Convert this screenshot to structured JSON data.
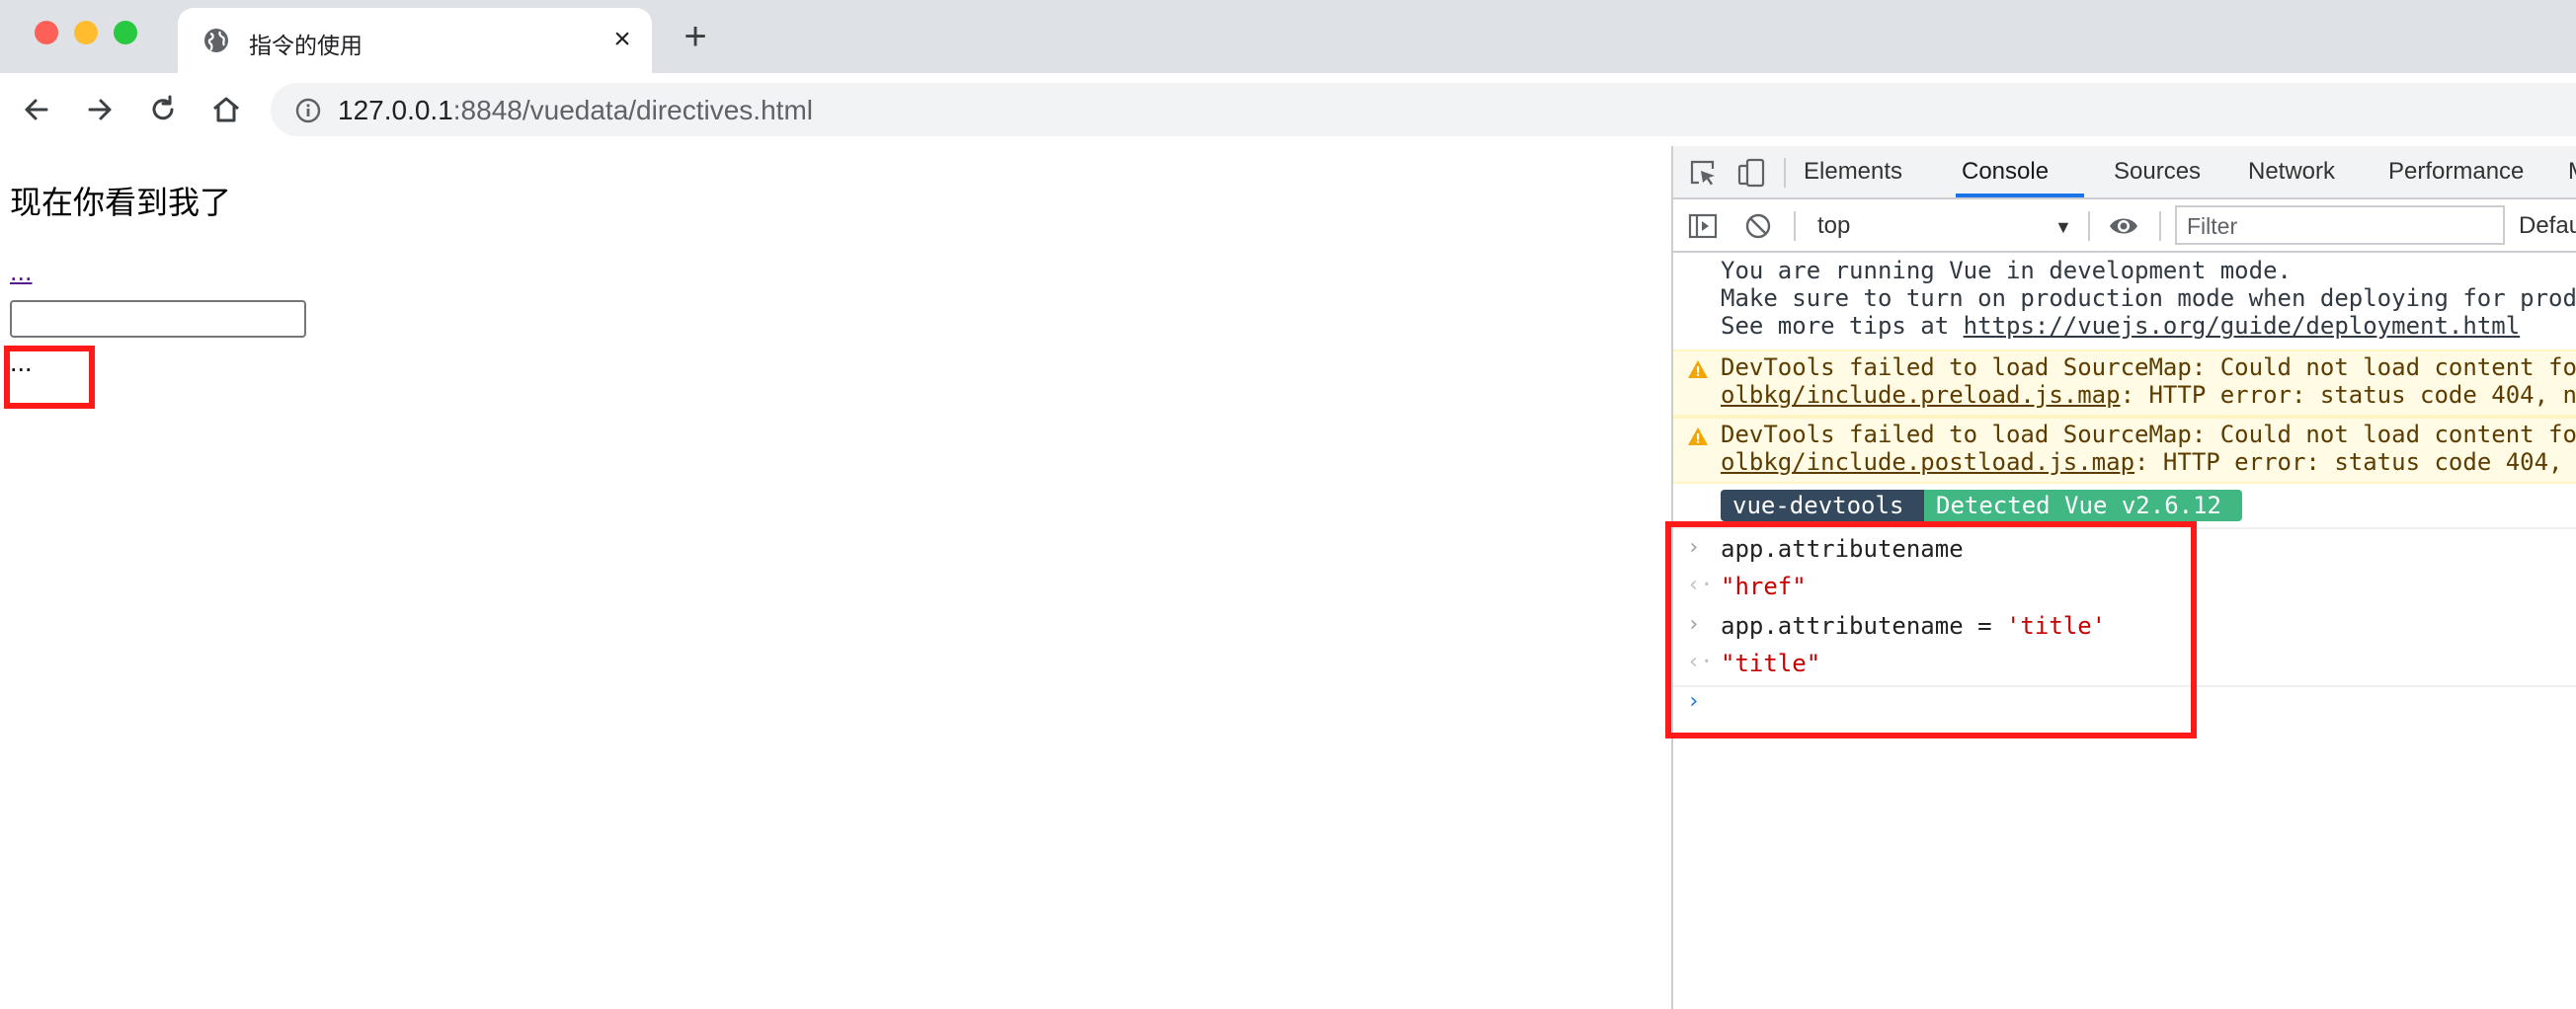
{
  "browser": {
    "tab_title": "指令的使用",
    "url_host": "127.0.0.1",
    "url_rest": ":8848/vuedata/directives.html",
    "icons": [
      "globe-icon",
      "close-icon",
      "plus-icon",
      "back-arrow-icon",
      "forward-arrow-icon",
      "reload-icon",
      "home-icon",
      "info-icon"
    ]
  },
  "page": {
    "heading": "现在你看到我了",
    "link_text": "...",
    "input_value": "",
    "text": "..."
  },
  "devtools": {
    "tabs": [
      "Elements",
      "Console",
      "Sources",
      "Network",
      "Performance",
      "M"
    ],
    "active_tab": "Console",
    "context": "top",
    "filter_placeholder": "Filter",
    "default_levels": "Defau",
    "icons": [
      "inspect-icon",
      "device-toggle-icon",
      "sidebar-toggle-icon",
      "clear-console-icon",
      "eye-icon",
      "warning-icon"
    ]
  },
  "console": {
    "info_lines": [
      "You are running Vue in development mode.",
      "Make sure to turn on production mode when deploying for prod",
      "See more tips at "
    ],
    "info_link": "https://vuejs.org/guide/deployment.html",
    "warnings": [
      {
        "line1": "DevTools failed to load SourceMap: Could not load content fo",
        "link": "olbkg/include.preload.js.map",
        "rest": ": HTTP error: status code 404, n"
      },
      {
        "line1": "DevTools failed to load SourceMap: Could not load content fo",
        "link": "olbkg/include.postload.js.map",
        "rest": ": HTTP error: status code 404,"
      }
    ],
    "badge_left": "vue-devtools",
    "badge_right": "Detected Vue v2.6.12",
    "entries": [
      {
        "kind": "input",
        "code": "app.attributename"
      },
      {
        "kind": "output",
        "value": "\"href\""
      },
      {
        "kind": "input",
        "code": "app.attributename = ",
        "string": "'title'"
      },
      {
        "kind": "output",
        "value": "\"title\""
      }
    ]
  },
  "colors": {
    "highlight": "#ff1a1a",
    "vue_dark": "#35495e",
    "vue_green": "#41b883",
    "warning_bg": "#fffbe5",
    "active_tab": "#1a73e8"
  }
}
